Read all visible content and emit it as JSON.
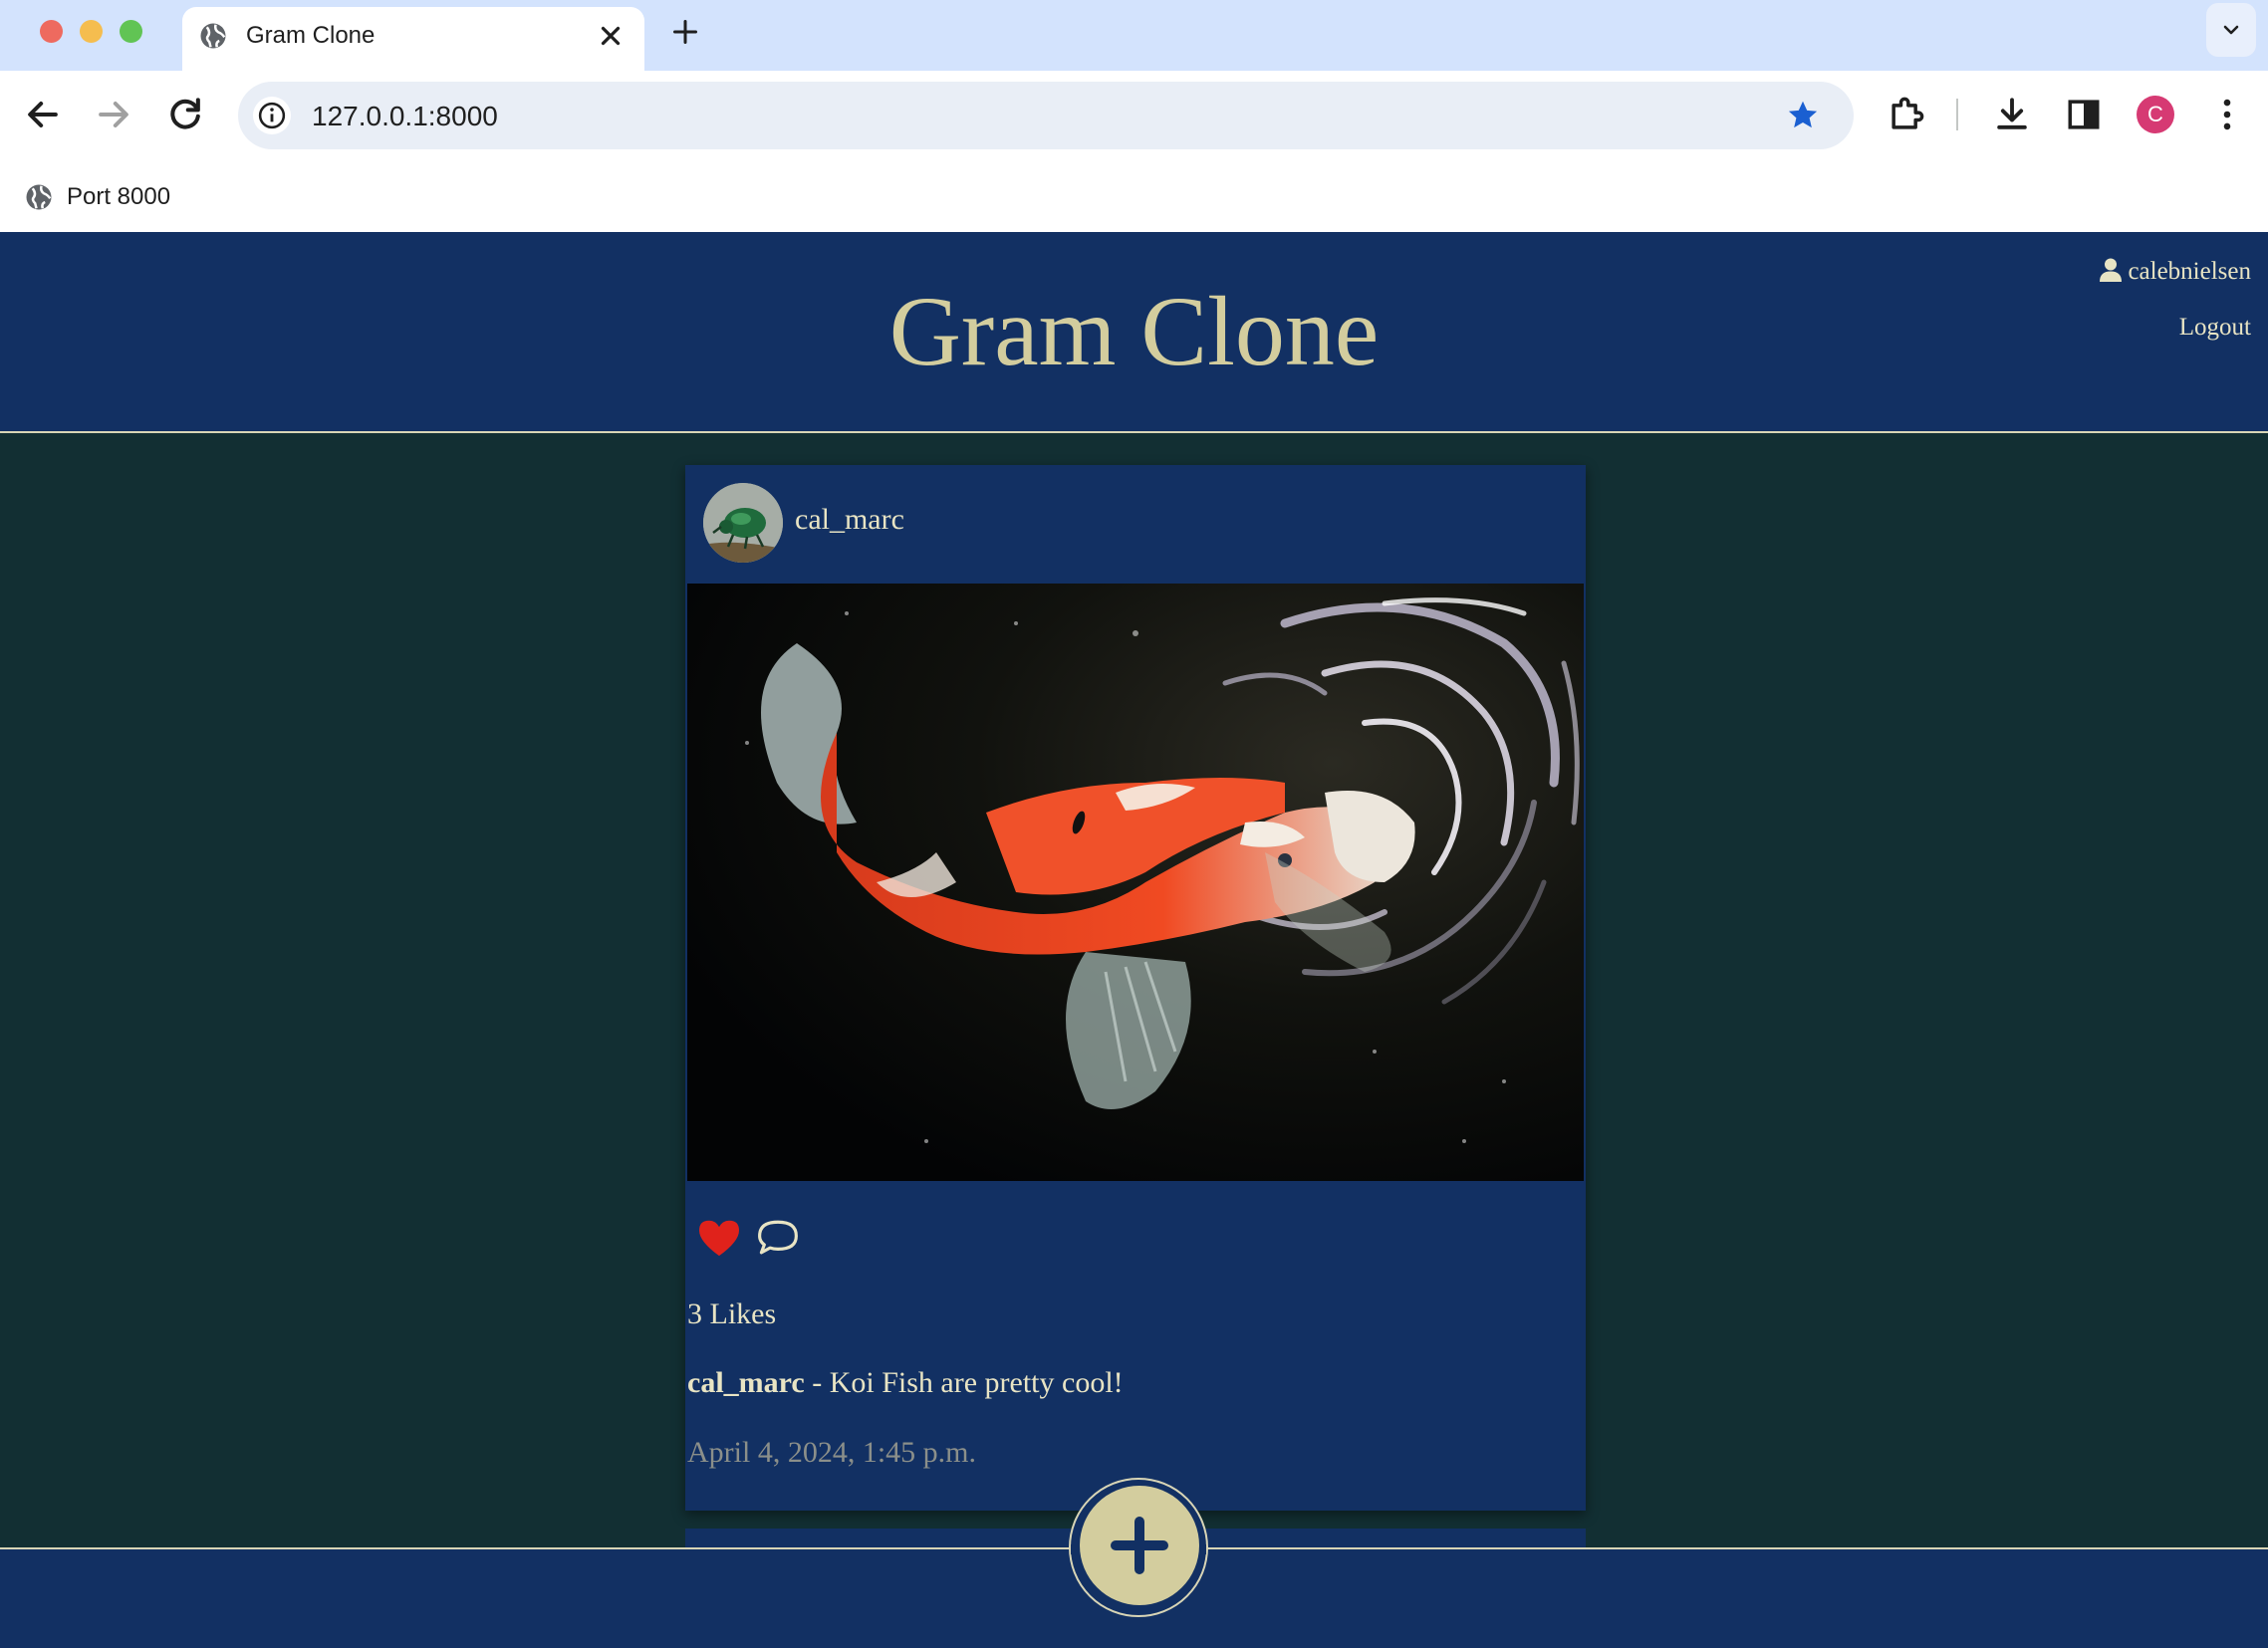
{
  "browser": {
    "tab_title": "Gram Clone",
    "url": "127.0.0.1:8000",
    "bookmark_label": "Port 8000",
    "profile_initial": "C"
  },
  "site": {
    "title": "Gram Clone",
    "username": "calebnielsen",
    "logout_label": "Logout"
  },
  "post": {
    "author": "cal_marc",
    "likes": "3 Likes",
    "caption_author": "cal_marc",
    "caption_text": " - Koi Fish are pretty cool!",
    "date": "April 4, 2024, 1:45 p.m."
  },
  "colors": {
    "header_bg": "#123063",
    "page_bg": "#122f33",
    "title_gold": "#d3cd9e",
    "heart_red": "#e0221b"
  }
}
